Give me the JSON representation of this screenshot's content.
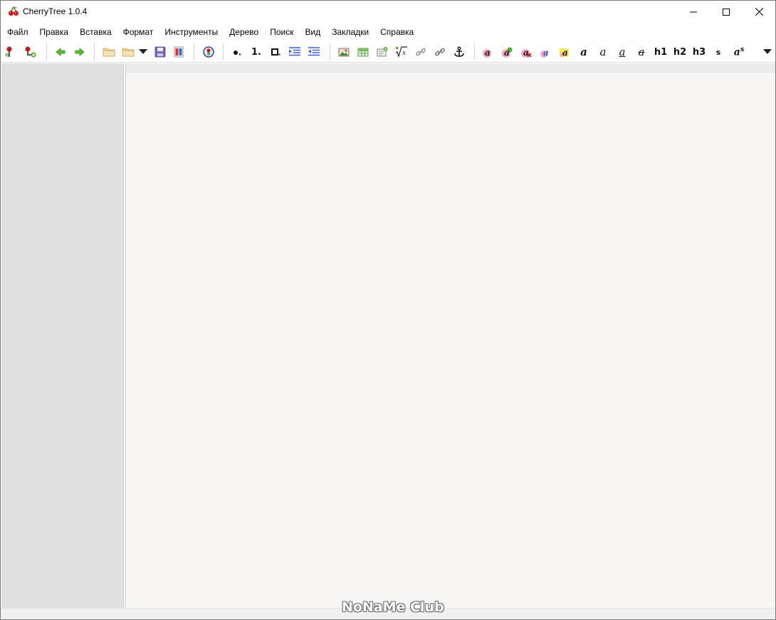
{
  "window": {
    "title": "CherryTree 1.0.4"
  },
  "menu": {
    "items": [
      {
        "label": "Файл"
      },
      {
        "label": "Правка"
      },
      {
        "label": "Вставка"
      },
      {
        "label": "Формат"
      },
      {
        "label": "Инструменты"
      },
      {
        "label": "Дерево"
      },
      {
        "label": "Поиск"
      },
      {
        "label": "Вид"
      },
      {
        "label": "Закладки"
      },
      {
        "label": "Справка"
      }
    ]
  },
  "toolbar": {
    "numbered_list_label": "1.",
    "h1_label": "h1",
    "h2_label": "h2",
    "h3_label": "h3",
    "small_label": "s",
    "superscript_label": "a",
    "superscript_sup": "s",
    "italic_a": "a",
    "bold_a": "a",
    "underline_a": "a",
    "strike_a": "a"
  },
  "watermark": {
    "text": "NoNaMe Club"
  },
  "colors": {
    "tree_bg": "#e0e0e0",
    "editor_bg": "#f8f7f5",
    "green_arrow": "#4caf28",
    "cherry_red": "#c0161c"
  }
}
